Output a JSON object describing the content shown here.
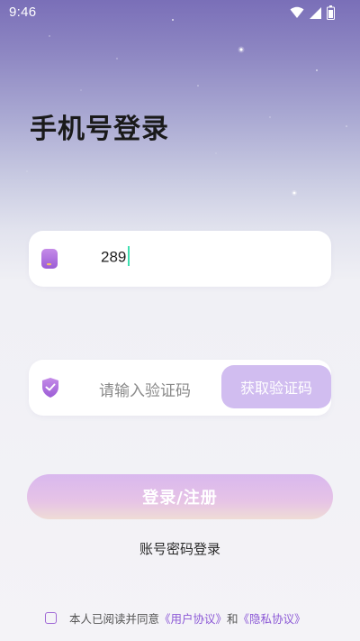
{
  "status_bar": {
    "time": "9:46",
    "icons": [
      "wifi-icon",
      "signal-icon",
      "battery-icon"
    ]
  },
  "page": {
    "title": "手机号登录"
  },
  "phone_input": {
    "icon": "phone-icon",
    "value": "289"
  },
  "code_input": {
    "icon": "shield-check-icon",
    "placeholder": "请输入验证码",
    "get_code_label": "获取验证码"
  },
  "actions": {
    "login_label": "登录/注册",
    "password_login_label": "账号密码登录"
  },
  "agreement": {
    "checked": false,
    "prefix": "本人已阅读并同意",
    "user_agreement": "《用户协议》",
    "conjunction": "和",
    "privacy_policy": "《隐私协议》"
  },
  "colors": {
    "accent": "#a069d6",
    "button_light": "#d1bdf0",
    "link": "#8c59d6",
    "cursor": "#3fdfb0"
  }
}
